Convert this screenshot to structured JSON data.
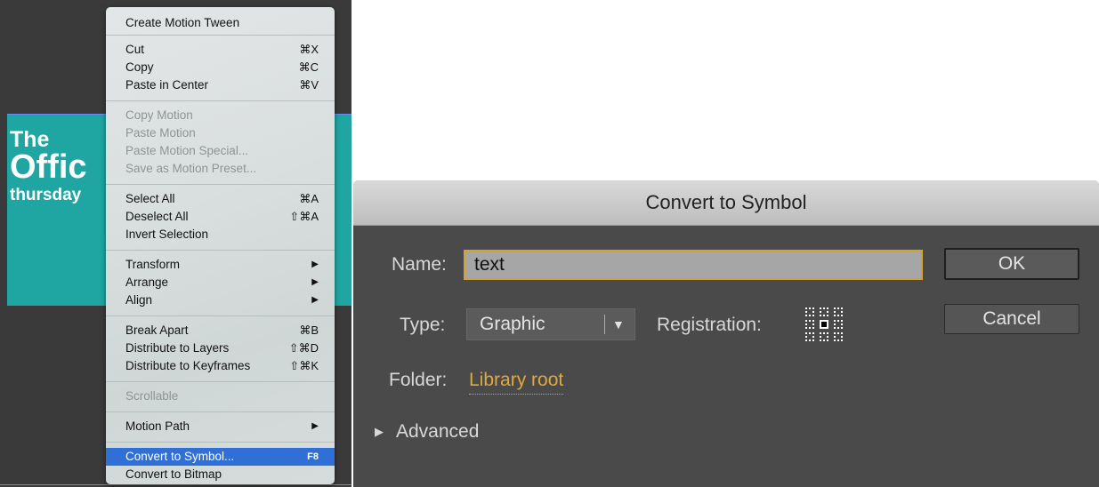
{
  "stage": {
    "banner_line1": "The",
    "banner_line2": "Offic",
    "banner_line3": "thursday",
    "banner_color": "#1fa6a2"
  },
  "context_menu": {
    "items": [
      {
        "label": "Create Motion Tween",
        "shortcut": "",
        "submenu": false,
        "disabled": false
      },
      {
        "label": "Cut",
        "shortcut": "⌘X",
        "submenu": false,
        "disabled": false
      },
      {
        "label": "Copy",
        "shortcut": "⌘C",
        "submenu": false,
        "disabled": false
      },
      {
        "label": "Paste in Center",
        "shortcut": "⌘V",
        "submenu": false,
        "disabled": false
      },
      {
        "label": "Copy Motion",
        "shortcut": "",
        "submenu": false,
        "disabled": true
      },
      {
        "label": "Paste Motion",
        "shortcut": "",
        "submenu": false,
        "disabled": true
      },
      {
        "label": "Paste Motion Special...",
        "shortcut": "",
        "submenu": false,
        "disabled": true
      },
      {
        "label": "Save as Motion Preset...",
        "shortcut": "",
        "submenu": false,
        "disabled": true
      },
      {
        "label": "Select All",
        "shortcut": "⌘A",
        "submenu": false,
        "disabled": false
      },
      {
        "label": "Deselect All",
        "shortcut": "⇧⌘A",
        "submenu": false,
        "disabled": false
      },
      {
        "label": "Invert Selection",
        "shortcut": "",
        "submenu": false,
        "disabled": false
      },
      {
        "label": "Transform",
        "shortcut": "",
        "submenu": true,
        "disabled": false
      },
      {
        "label": "Arrange",
        "shortcut": "",
        "submenu": true,
        "disabled": false
      },
      {
        "label": "Align",
        "shortcut": "",
        "submenu": true,
        "disabled": false
      },
      {
        "label": "Break Apart",
        "shortcut": "⌘B",
        "submenu": false,
        "disabled": false
      },
      {
        "label": "Distribute to Layers",
        "shortcut": "⇧⌘D",
        "submenu": false,
        "disabled": false
      },
      {
        "label": "Distribute to Keyframes",
        "shortcut": "⇧⌘K",
        "submenu": false,
        "disabled": false
      },
      {
        "label": "Scrollable",
        "shortcut": "",
        "submenu": false,
        "disabled": true
      },
      {
        "label": "Motion Path",
        "shortcut": "",
        "submenu": true,
        "disabled": false
      },
      {
        "label": "Convert to Symbol...",
        "shortcut": "F8",
        "submenu": false,
        "disabled": false,
        "highlighted": true
      },
      {
        "label": "Convert to Bitmap",
        "shortcut": "",
        "submenu": false,
        "disabled": false
      }
    ],
    "submenu_arrow": "▶",
    "highlight_color": "#2f6fd6"
  },
  "dialog": {
    "title": "Convert to Symbol",
    "name_label": "Name:",
    "name_value": "text",
    "type_label": "Type:",
    "type_value": "Graphic",
    "registration_label": "Registration:",
    "folder_label": "Folder:",
    "folder_value": "Library root",
    "advanced_label": "Advanced",
    "ok_label": "OK",
    "cancel_label": "Cancel",
    "accent_color": "#d3a233"
  }
}
